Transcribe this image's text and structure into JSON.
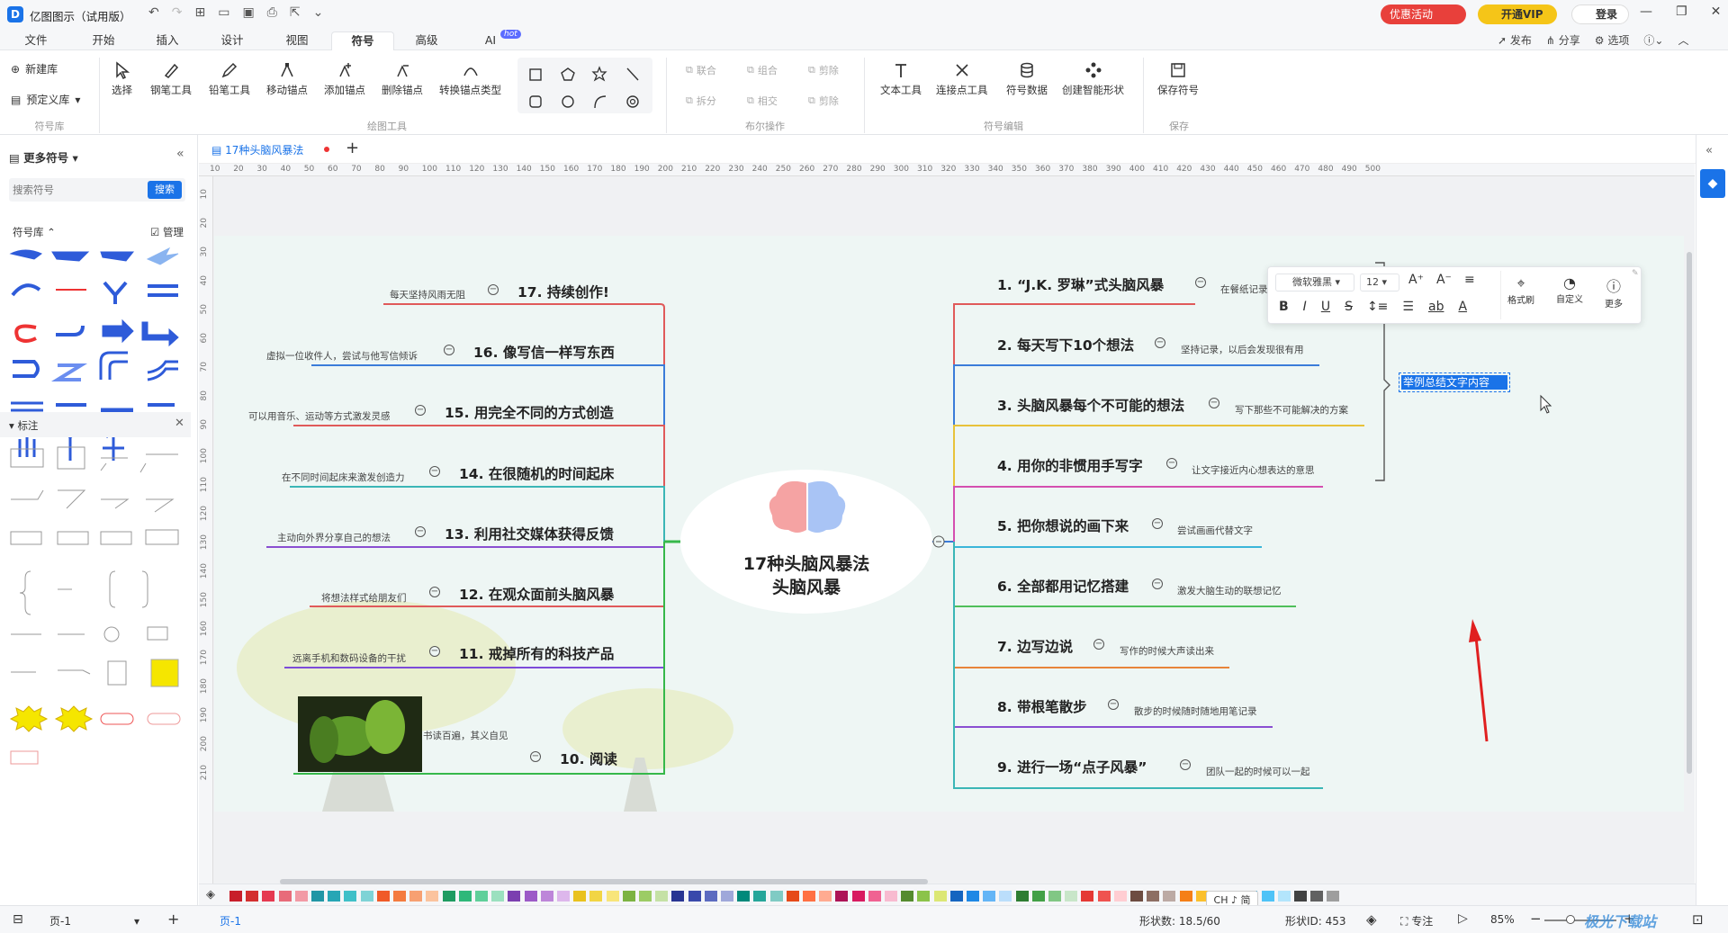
{
  "app": {
    "title": "亿图图示（试用版）",
    "promo": "优惠活动",
    "vip": "开通VIP",
    "login": "登录"
  },
  "menu_tabs": [
    "文件",
    "开始",
    "插入",
    "设计",
    "视图",
    "符号",
    "高级",
    "AI"
  ],
  "ai_badge": "hot",
  "right_actions": {
    "publish": "发布",
    "share": "分享",
    "options": "选项"
  },
  "ribbon": {
    "symbol_lib": {
      "new": "新建库",
      "predefined": "预定义库",
      "group": "符号库"
    },
    "draw_tools": {
      "items": [
        "选择",
        "钢笔工具",
        "铅笔工具",
        "移动锚点",
        "添加锚点",
        "删除锚点",
        "转换锚点类型"
      ],
      "group": "绘图工具"
    },
    "boolean": {
      "items": [
        "联合",
        "组合",
        "剪除",
        "拆分",
        "相交",
        "剪除"
      ],
      "group": "布尔操作"
    },
    "symbol_edit": {
      "items": [
        "文本工具",
        "连接点工具",
        "符号数据",
        "创建智能形状"
      ],
      "group": "符号编辑"
    },
    "save": {
      "items": [
        "保存符号"
      ],
      "group": "保存"
    }
  },
  "left_panel": {
    "title": "更多符号",
    "search_placeholder": "搜索符号",
    "search_btn": "搜索",
    "lib_label": "符号库",
    "manage": "管理",
    "section": "标注"
  },
  "doc_tab": "17种头脑风暴法",
  "ruler_h": [
    "10",
    "20",
    "30",
    "40",
    "50",
    "60",
    "70",
    "80",
    "90",
    "100",
    "110",
    "120",
    "130",
    "140",
    "150",
    "160",
    "170",
    "180",
    "190",
    "200",
    "210",
    "220",
    "230",
    "240",
    "250",
    "260",
    "270",
    "280",
    "290",
    "300",
    "310",
    "320",
    "330",
    "340",
    "350",
    "360",
    "370",
    "380",
    "390",
    "400",
    "410",
    "420",
    "430",
    "440",
    "450",
    "460",
    "470",
    "480",
    "490",
    "500"
  ],
  "ruler_v": [
    "10",
    "20",
    "30",
    "40",
    "50",
    "60",
    "70",
    "80",
    "90",
    "100",
    "110",
    "120",
    "130",
    "140",
    "150",
    "160",
    "170",
    "180",
    "190",
    "200",
    "210"
  ],
  "mindmap": {
    "center_line1": "17种头脑风暴法",
    "center_line2": "头脑风暴",
    "left": [
      {
        "title": "17. 持续创作!",
        "note": "每天坚持风雨无阻"
      },
      {
        "title": "16. 像写信一样写东西",
        "note": "虚拟一位收件人，尝试与他写信倾诉"
      },
      {
        "title": "15. 用完全不同的方式创造",
        "note": "可以用音乐、运动等方式激发灵感"
      },
      {
        "title": "14. 在很随机的时间起床",
        "note": "在不同时间起床来激发创造力"
      },
      {
        "title": "13. 利用社交媒体获得反馈",
        "note": "主动向外界分享自己的想法"
      },
      {
        "title": "12. 在观众面前头脑风暴",
        "note": "将想法样式给朋友们"
      },
      {
        "title": "11. 戒掉所有的科技产品",
        "note": "远离手机和数码设备的干扰"
      },
      {
        "title": "10. 阅读",
        "note": "书读百遍，其义自见"
      }
    ],
    "right": [
      {
        "title": "1. “J.K. 罗琳”式头脑风暴",
        "note": "在餐纸记录"
      },
      {
        "title": "2. 每天写下10个想法",
        "note": "坚持记录，以后会发现很有用"
      },
      {
        "title": "3. 头脑风暴每个不可能的想法",
        "note": "写下那些不可能解决的方案"
      },
      {
        "title": "4. 用你的非惯用手写字",
        "note": "让文字接近内心想表达的意思"
      },
      {
        "title": "5. 把你想说的画下来",
        "note": "尝试画画代替文字"
      },
      {
        "title": "6. 全部都用记忆搭建",
        "note": "激发大脑生动的联想记忆"
      },
      {
        "title": "7. 边写边说",
        "note": "写作的时候大声读出来"
      },
      {
        "title": "8. 带根笔散步",
        "note": "散步的时候随时随地用笔记录"
      },
      {
        "title": "9. 进行一场“点子风暴”",
        "note": "团队一起的时候可以一起"
      }
    ],
    "summary_text": "举例总结文字内容"
  },
  "float_toolbar": {
    "font": "微软雅黑",
    "size": "12",
    "format_brush": "格式刷",
    "custom": "自定义",
    "more": "更多"
  },
  "ime": "CH ♪ 简",
  "status": {
    "page_sel": "页-1",
    "page_tab": "页-1",
    "shape_count": "形状数: 18.5/60",
    "shape_id": "形状ID: 453",
    "focus": "专注",
    "zoom": "85%"
  },
  "watermark": "极光下载站",
  "colors": {
    "accent": "#1a73e8",
    "promo": "#e8403b",
    "vip": "#f5c518"
  }
}
